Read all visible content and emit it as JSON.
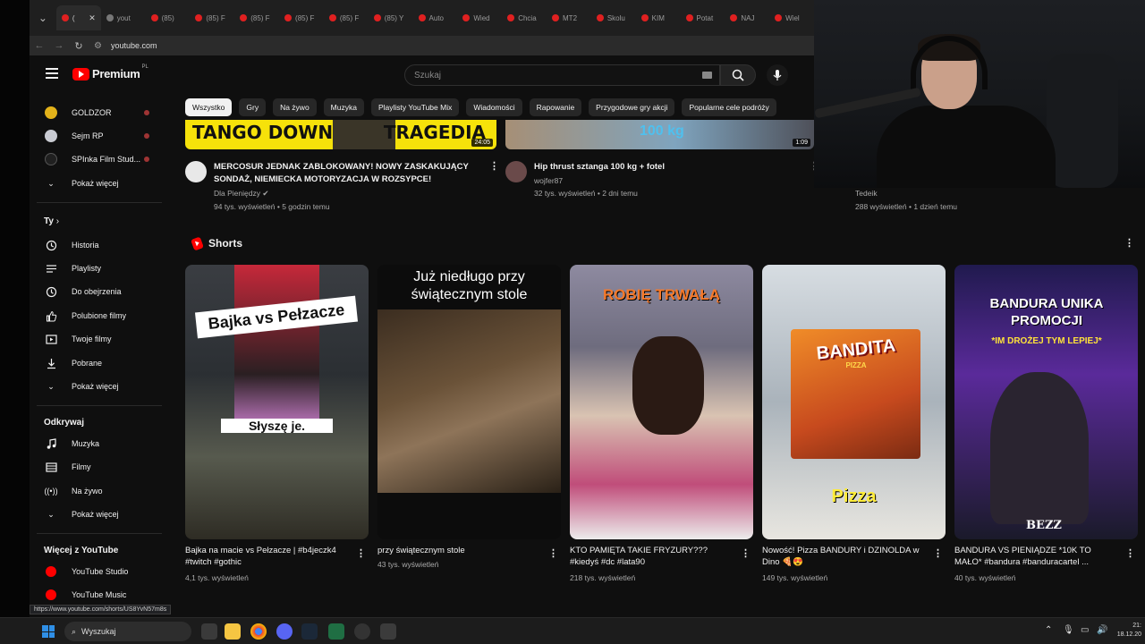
{
  "browser": {
    "tabs": [
      {
        "label": "(",
        "active": true
      },
      {
        "label": "yout"
      },
      {
        "label": "(85)"
      },
      {
        "label": "(85) F"
      },
      {
        "label": "(85) F"
      },
      {
        "label": "(85) F"
      },
      {
        "label": "(85) F"
      },
      {
        "label": "(85) Y"
      },
      {
        "label": "Auto"
      },
      {
        "label": "Wied"
      },
      {
        "label": "Chcia"
      },
      {
        "label": "MT2"
      },
      {
        "label": "Skolu"
      },
      {
        "label": "KIM"
      },
      {
        "label": "Potat"
      },
      {
        "label": "NAJ"
      },
      {
        "label": "Wiel"
      }
    ],
    "url": "youtube.com",
    "status_url": "https://www.youtube.com/shorts/US8YvN57m8s"
  },
  "header": {
    "logo_text": "Premium",
    "logo_sup": "PL",
    "search_placeholder": "Szukaj"
  },
  "sidebar": {
    "subs": [
      {
        "label": "GOLDZOR",
        "color": "#e3b21a"
      },
      {
        "label": "Sejm RP",
        "color": "#c9cbd2"
      },
      {
        "label": "SPInka Film Stud...",
        "color": "#202020"
      }
    ],
    "subs_more": "Pokaż więcej",
    "you_heading": "Ty",
    "you_items": [
      {
        "label": "Historia",
        "icon": "history-icon"
      },
      {
        "label": "Playlisty",
        "icon": "playlist-icon"
      },
      {
        "label": "Do obejrzenia",
        "icon": "watch-later-icon"
      },
      {
        "label": "Polubione filmy",
        "icon": "like-icon"
      },
      {
        "label": "Twoje filmy",
        "icon": "your-videos-icon"
      },
      {
        "label": "Pobrane",
        "icon": "download-icon"
      }
    ],
    "you_more": "Pokaż więcej",
    "explore_heading": "Odkrywaj",
    "explore_items": [
      {
        "label": "Muzyka",
        "icon": "music-icon"
      },
      {
        "label": "Filmy",
        "icon": "film-icon"
      },
      {
        "label": "Na żywo",
        "icon": "live-icon"
      }
    ],
    "explore_more": "Pokaż więcej",
    "more_heading": "Więcej z YouTube",
    "more_items": [
      {
        "label": "YouTube Studio"
      },
      {
        "label": "YouTube Music"
      }
    ]
  },
  "chips": [
    "Wszystko",
    "Gry",
    "Na żywo",
    "Muzyka",
    "Playlisty YouTube Mix",
    "Wiadomości",
    "Rapowanie",
    "Przygodowe gry akcji",
    "Popularne cele podróży"
  ],
  "videos": [
    {
      "thumb_left": "TANGO DOWN",
      "thumb_right": "TRAGEDIA",
      "duration": "24:05",
      "title": "MERCOSUR JEDNAK ZABLOKOWANY! NOWY ZASKAKUJĄCY SONDAŻ, NIEMIECKA MOTORYZACJA W ROZSYPCE!",
      "channel": "Dla Pieniędzy",
      "meta": "94 tys. wyświetleń • 5 godzin temu"
    },
    {
      "thumb_text": "100 kg",
      "duration": "1:09",
      "title": "Hip thrust sztanga 100 kg + fotel",
      "channel": "wojfer87",
      "meta": "32 tys. wyświetleń • 2 dni temu"
    },
    {
      "channel": "Tedeik",
      "meta": "288 wyświetleń • 1 dzień temu"
    }
  ],
  "shorts_heading": "Shorts",
  "shorts": [
    {
      "overlay": "Bajka vs Pełzacze",
      "overlay2": "Słyszę je.",
      "title": "Bajka na macie vs Pełzacze | #b4jeczk4 #twitch #gothic",
      "views": "4,1 tys. wyświetleń"
    },
    {
      "overlay": "Już niedługo przy świątecznym stole",
      "title": "przy świątecznym stole",
      "views": "43 tys. wyświetleń"
    },
    {
      "overlay": "ROBIĘ TRWAŁĄ",
      "title": "KTO PAMIĘTA TAKIE FRYZURY??? #kiedyś #dc #lata90",
      "views": "218 tys. wyświetleń"
    },
    {
      "overlay": "BANDITA",
      "overlay_sub": "PIZZA",
      "overlay2": "Pizza",
      "title": "Nowość! Pizza BANDURY i DZINOLDA w Dino 🍕😍",
      "views": "149 tys. wyświetleń"
    },
    {
      "overlay": "BANDURA UNIKA PROMOCJI",
      "overlay_sub": "*IM DROŻEJ TYM LEPIEJ*",
      "overlay2": "BEZZ",
      "title": "BANDURA VS PIENIĄDZE *10K TO MAŁO* #bandura #banduracartel ...",
      "views": "40 tys. wyświetleń"
    }
  ],
  "taskbar": {
    "search_label": "Wyszukaj",
    "time": "21:",
    "date": "18.12.20"
  }
}
